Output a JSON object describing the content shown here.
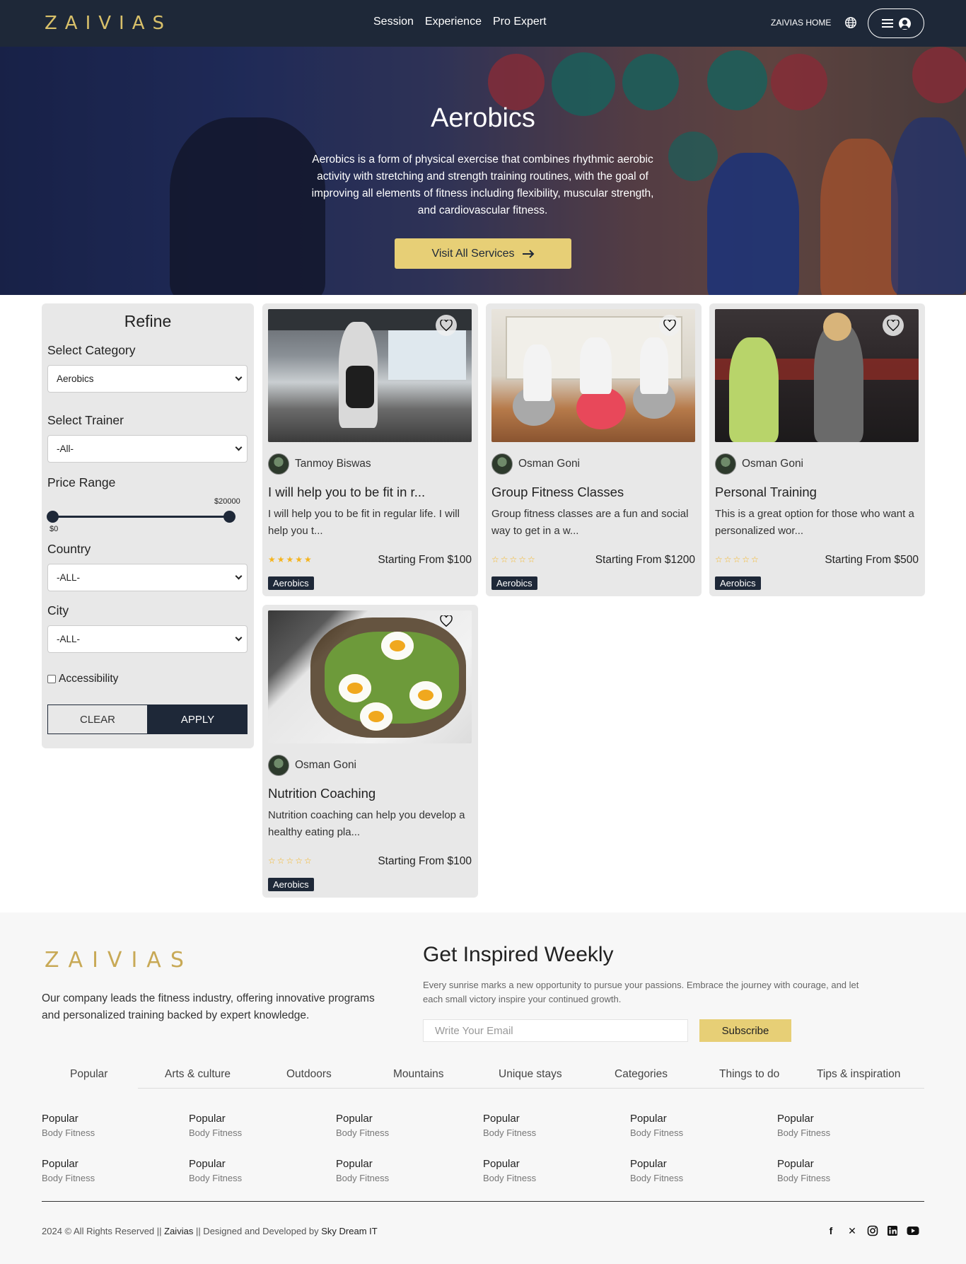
{
  "nav": {
    "logo": "ZAIVIAS",
    "links": [
      "Session",
      "Experience",
      "Pro Expert"
    ],
    "home_label": "ZAIVIAS HOME",
    "globe_icon": "globe-icon",
    "menu_icon": "hamburger-icon",
    "user_icon": "user-icon"
  },
  "hero": {
    "title": "Aerobics",
    "description": "Aerobics is a form of physical exercise that combines rhythmic aerobic activity with stretching and strength training routines, with the goal of improving all elements of fitness including flexibility, muscular strength, and cardiovascular fitness.",
    "button_label": "Visit All Services",
    "button_icon": "arrow-right-icon"
  },
  "refine": {
    "title": "Refine",
    "category_label": "Select Category",
    "category_value": "Aerobics",
    "trainer_label": "Select Trainer",
    "trainer_value": "-All-",
    "price_label": "Price Range",
    "price_min": "$0",
    "price_max": "$20000",
    "country_label": "Country",
    "country_value": "-ALL-",
    "city_label": "City",
    "city_value": "-ALL-",
    "accessibility_label": "Accessibility",
    "accessibility_checked": false,
    "clear_label": "CLEAR",
    "apply_label": "APPLY"
  },
  "cards": [
    {
      "trainer": "Tanmoy Biswas",
      "title": "I will help you to be fit in r...",
      "description": "I will help you to be fit in regular life. I will help you t...",
      "rating": 5,
      "stars": "★★★★★",
      "price": "Starting From $100",
      "tag": "Aerobics"
    },
    {
      "trainer": "Osman Goni",
      "title": "Group Fitness Classes",
      "description": "Group fitness classes are a fun and social way to get in a w...",
      "rating": 0,
      "stars": "☆☆☆☆☆",
      "price": "Starting From $1200",
      "tag": "Aerobics"
    },
    {
      "trainer": "Osman Goni",
      "title": "Personal Training",
      "description": "This is a great option for those who want a personalized wor...",
      "rating": 0,
      "stars": "☆☆☆☆☆",
      "price": "Starting From $500",
      "tag": "Aerobics"
    },
    {
      "trainer": "Osman Goni",
      "title": "Nutrition Coaching",
      "description": "Nutrition coaching can help you develop a healthy eating pla...",
      "rating": 0,
      "stars": "☆☆☆☆☆",
      "price": "Starting From $100",
      "tag": "Aerobics"
    }
  ],
  "footer": {
    "logo": "ZAIVIAS",
    "about": "Our company leads the fitness industry, offering innovative programs and personalized training backed by expert knowledge.",
    "inspired_title": "Get Inspired Weekly",
    "inspired_text": "Every sunrise marks a new opportunity to pursue your passions. Embrace the journey with courage, and let each small victory inspire your continued growth.",
    "email_placeholder": "Write Your Email",
    "subscribe_label": "Subscribe",
    "tabs": [
      "Popular",
      "Arts & culture",
      "Outdoors",
      "Mountains",
      "Unique stays",
      "Categories",
      "Things to do",
      "Tips & inspiration"
    ],
    "grid_heading": "Popular",
    "grid_sub": "Body Fitness",
    "copyright_prefix": "2024 © All Rights Reserved || ",
    "copyright_brand": "Zaivias",
    "copyright_mid": " || Designed and Developed by ",
    "copyright_dev": "Sky Dream IT",
    "social": [
      "facebook-icon",
      "x-icon",
      "instagram-icon",
      "linkedin-icon",
      "youtube-icon"
    ]
  },
  "colors": {
    "navy": "#1e2838",
    "gold": "#e7cf76",
    "logo_gold": "#d8c06a",
    "card_bg": "#e8e8e8"
  }
}
